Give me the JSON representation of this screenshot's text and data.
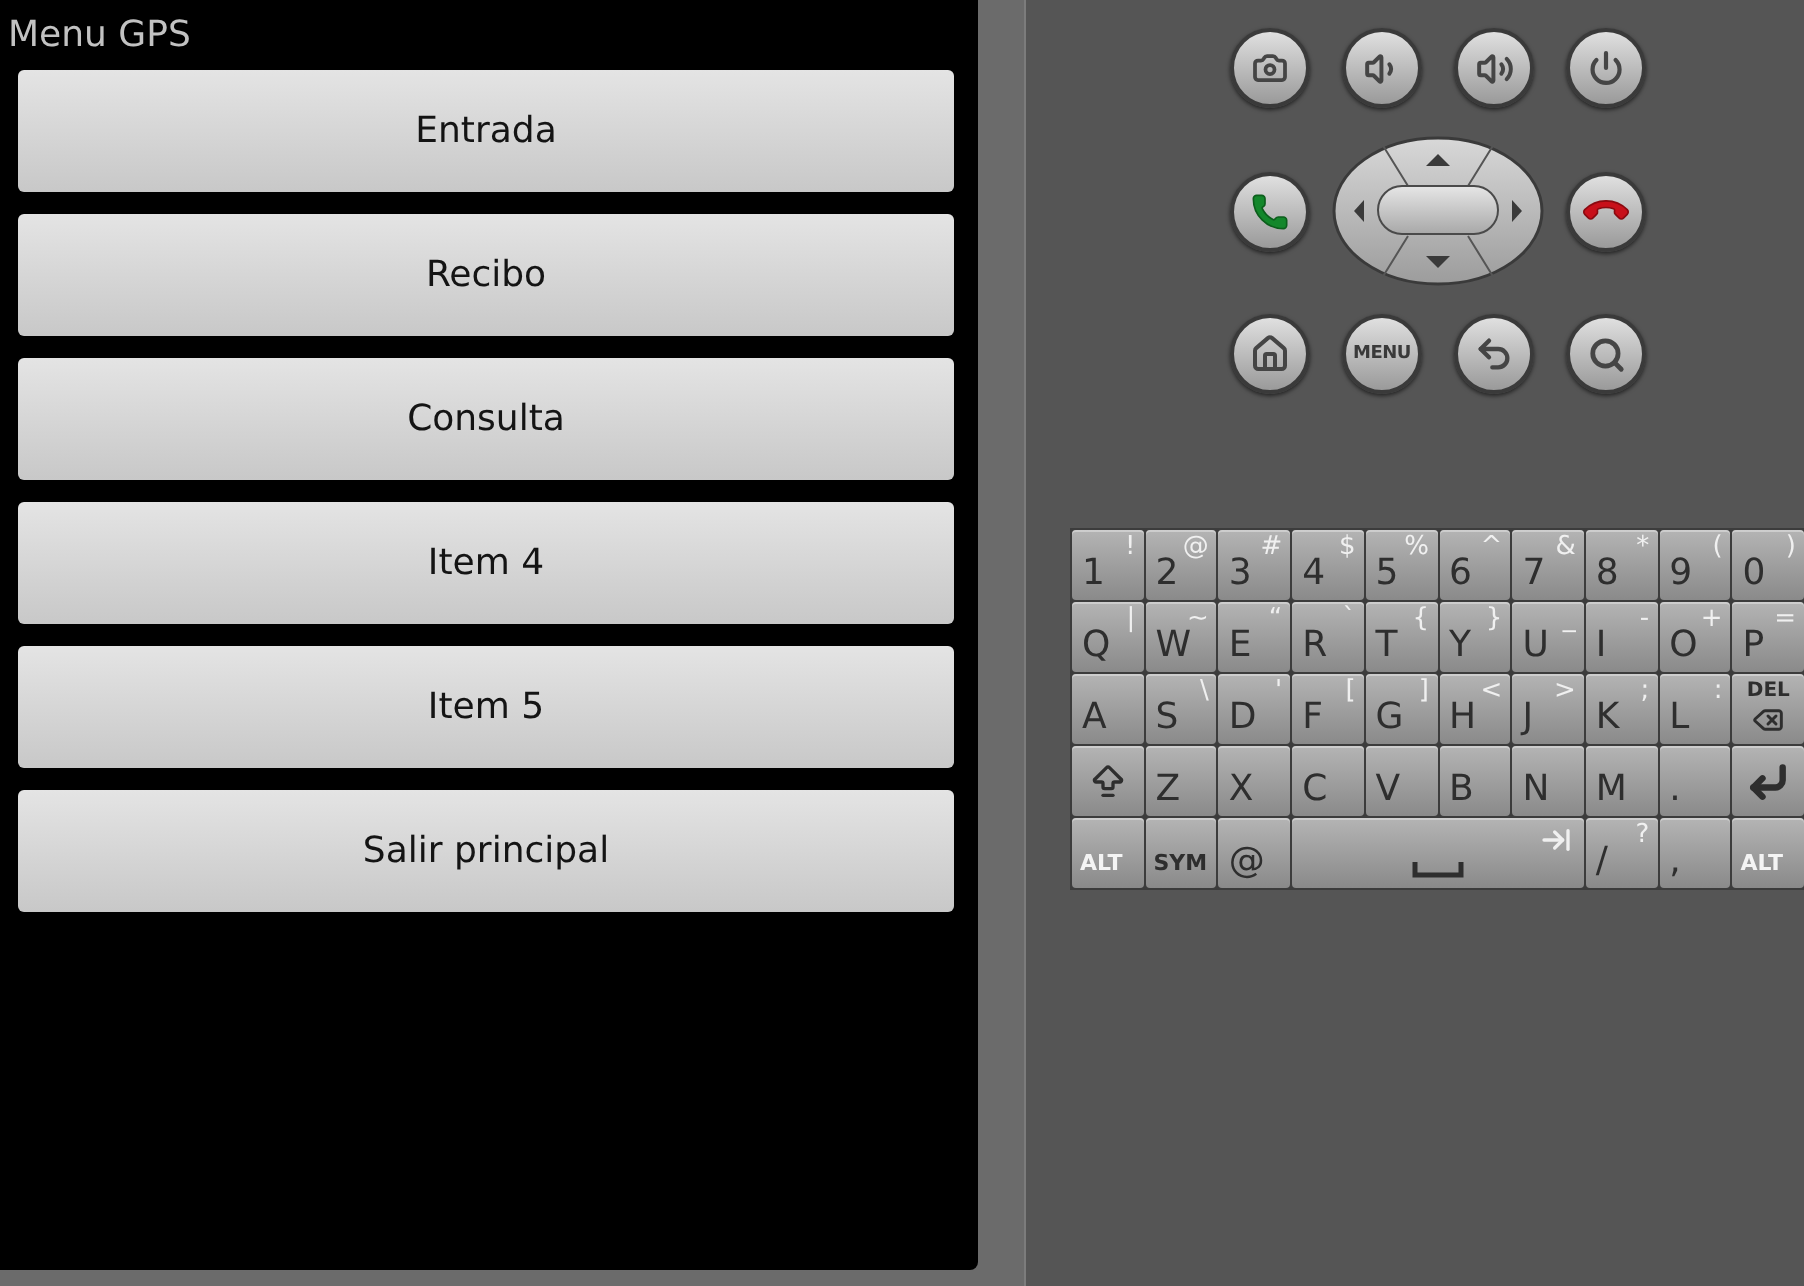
{
  "screen": {
    "title": "Menu GPS",
    "buttons": [
      {
        "label": "Entrada"
      },
      {
        "label": "Recibo"
      },
      {
        "label": "Consulta"
      },
      {
        "label": "Item 4"
      },
      {
        "label": "Item 5"
      },
      {
        "label": "Salir principal"
      }
    ]
  },
  "device_keys": {
    "menu_label": "MENU"
  },
  "keyboard": {
    "rows": [
      [
        {
          "kind": "char",
          "label": "1",
          "alt": "!"
        },
        {
          "kind": "char",
          "label": "2",
          "alt": "@"
        },
        {
          "kind": "char",
          "label": "3",
          "alt": "#"
        },
        {
          "kind": "char",
          "label": "4",
          "alt": "$"
        },
        {
          "kind": "char",
          "label": "5",
          "alt": "%"
        },
        {
          "kind": "char",
          "label": "6",
          "alt": "^"
        },
        {
          "kind": "char",
          "label": "7",
          "alt": "&"
        },
        {
          "kind": "char",
          "label": "8",
          "alt": "*"
        },
        {
          "kind": "char",
          "label": "9",
          "alt": "("
        },
        {
          "kind": "char",
          "label": "0",
          "alt": ")"
        }
      ],
      [
        {
          "kind": "char",
          "label": "Q",
          "alt": "|"
        },
        {
          "kind": "char",
          "label": "W",
          "alt": "~"
        },
        {
          "kind": "char",
          "label": "E",
          "alt": "“"
        },
        {
          "kind": "char",
          "label": "R",
          "alt": "`"
        },
        {
          "kind": "char",
          "label": "T",
          "alt": "{"
        },
        {
          "kind": "char",
          "label": "Y",
          "alt": "}"
        },
        {
          "kind": "char",
          "label": "U",
          "alt": "_"
        },
        {
          "kind": "char",
          "label": "I",
          "alt": "-"
        },
        {
          "kind": "char",
          "label": "O",
          "alt": "+"
        },
        {
          "kind": "char",
          "label": "P",
          "alt": "="
        }
      ],
      [
        {
          "kind": "char",
          "label": "A"
        },
        {
          "kind": "char",
          "label": "S",
          "alt": "\\"
        },
        {
          "kind": "char",
          "label": "D",
          "alt": "'"
        },
        {
          "kind": "char",
          "label": "F",
          "alt": "["
        },
        {
          "kind": "char",
          "label": "G",
          "alt": "]"
        },
        {
          "kind": "char",
          "label": "H",
          "alt": "<"
        },
        {
          "kind": "char",
          "label": "J",
          "alt": ">"
        },
        {
          "kind": "char",
          "label": "K",
          "alt": ";"
        },
        {
          "kind": "char",
          "label": "L",
          "alt": ":"
        },
        {
          "kind": "del",
          "label": "DEL"
        }
      ],
      [
        {
          "kind": "shift"
        },
        {
          "kind": "char",
          "label": "Z"
        },
        {
          "kind": "char",
          "label": "X"
        },
        {
          "kind": "char",
          "label": "C"
        },
        {
          "kind": "char",
          "label": "V"
        },
        {
          "kind": "char",
          "label": "B"
        },
        {
          "kind": "char",
          "label": "N"
        },
        {
          "kind": "char",
          "label": "M"
        },
        {
          "kind": "char",
          "label": "."
        },
        {
          "kind": "enter"
        }
      ]
    ],
    "bottom_row": {
      "left_keys": [
        {
          "kind": "alt",
          "label": "ALT"
        },
        {
          "kind": "sym",
          "label": "SYM"
        },
        {
          "kind": "char",
          "label": "@"
        }
      ],
      "right_keys": [
        {
          "kind": "char",
          "label": "/",
          "alt": "?"
        },
        {
          "kind": "char",
          "label": ","
        },
        {
          "kind": "alt",
          "label": "ALT"
        }
      ]
    }
  }
}
